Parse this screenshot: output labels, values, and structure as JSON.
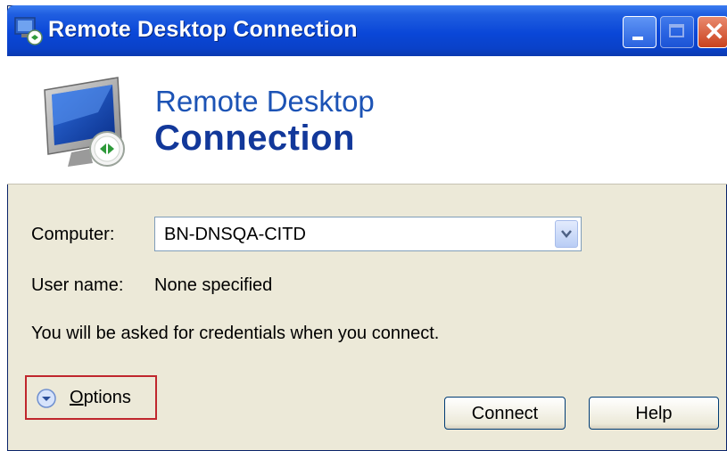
{
  "window": {
    "title": "Remote Desktop Connection",
    "controls": [
      "minimize",
      "maximize",
      "close"
    ]
  },
  "banner": {
    "line1": "Remote Desktop",
    "line2": "Connection",
    "icon": "remote-desktop-monitor-icon"
  },
  "form": {
    "computer_label": "Computer:",
    "computer_value": "BN-DNSQA-CITD",
    "user_label": "User name:",
    "user_value": "None specified",
    "info": "You will be asked for credentials when you connect."
  },
  "footer": {
    "options_label_mnemonic": "O",
    "options_label_rest": "ptions",
    "connect_label": "Connect",
    "help_label": "Help"
  },
  "colors": {
    "titlebar": "#0a47d8",
    "banner_text": "#1c53b5",
    "highlight_box": "#c0272d",
    "dialog_bg": "#ece9d8"
  }
}
